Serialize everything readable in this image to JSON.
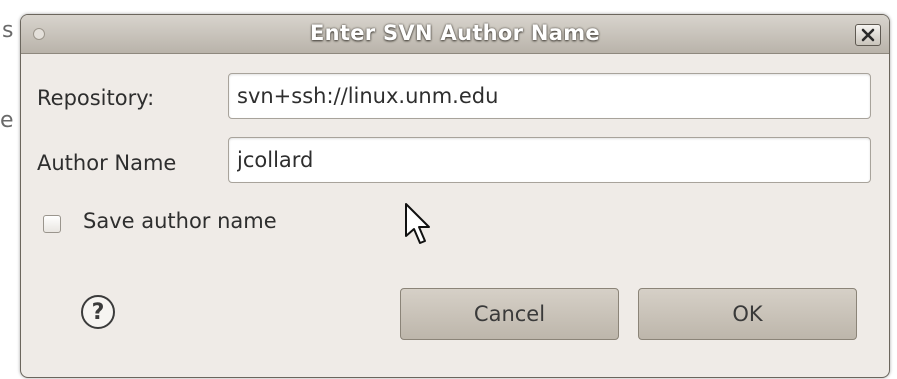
{
  "dialog": {
    "title": "Enter SVN Author Name",
    "repository_label": "Repository:",
    "repository_value": "svn+ssh://linux.unm.edu",
    "author_label": "Author Name",
    "author_value": "jcollard",
    "save_checkbox_label": "Save author name",
    "save_checkbox_checked": false,
    "cancel_label": "Cancel",
    "ok_label": "OK",
    "help_glyph": "?",
    "close_icon": "close-icon",
    "help_icon": "help-icon"
  },
  "colors": {
    "dialog_bg": "#efebe7",
    "titlebar_top": "#d8d4cd",
    "titlebar_bottom": "#b9b3aa",
    "button_bg": "#c9c2b7"
  }
}
